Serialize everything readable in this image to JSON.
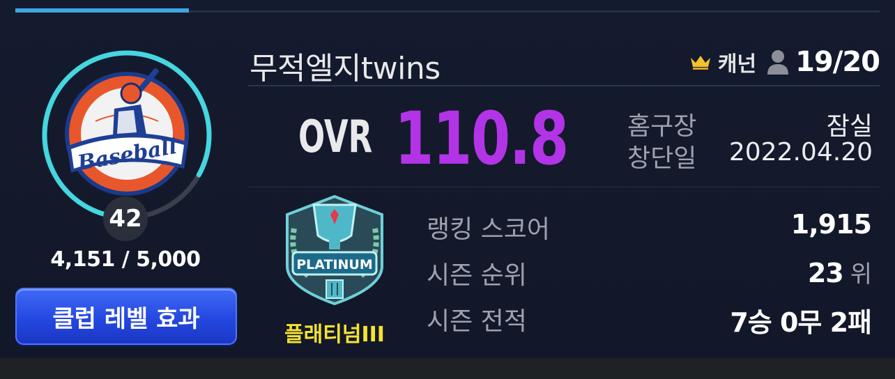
{
  "club": {
    "name": "무적엘지twins",
    "level": "42",
    "xp": "4,151 / 5,000",
    "xp_progress": 0.83,
    "level_effect_button": "클럽 레벨 효과",
    "logo_text": "Baseball"
  },
  "manager": {
    "name": "캐넌",
    "member_count": "19/20"
  },
  "stats": {
    "ovr_label": "OVR",
    "ovr_value": "110.8",
    "home_label": "홈구장",
    "home_value": "잠실",
    "founded_label": "창단일",
    "founded_value": "2022.04.20"
  },
  "tier": {
    "name": "플래티넘III",
    "emblem_text": "PLATINUM"
  },
  "ranking": {
    "score_label": "랭킹 스코어",
    "score_value": "1,915",
    "season_rank_label": "시즌 순위",
    "season_rank_value": "23",
    "season_rank_unit": "위",
    "season_record_label": "시즌 전적",
    "season_record_value": "7승 0무 2패"
  },
  "colors": {
    "ovr": "#b334e6",
    "level_ring": "#45d6e0",
    "tab_active": "#3fa6e3",
    "button": "#2a4ee6",
    "tier_text": "#f5e332"
  }
}
